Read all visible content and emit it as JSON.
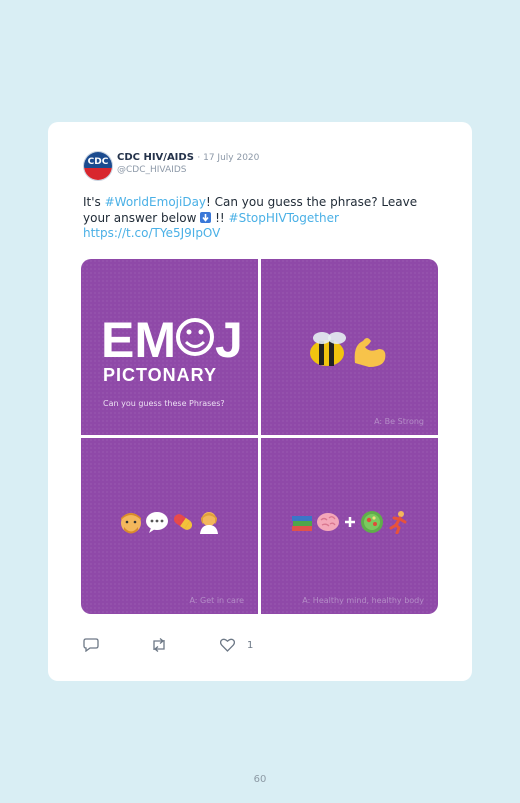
{
  "tweet": {
    "display_name": "CDC HIV/AIDS",
    "date": "· 17 July 2020",
    "handle": "@CDC_HIVAIDS",
    "text_part1": "It's ",
    "hashtag1": "#WorldEmojiDay",
    "text_part2": "! Can you guess the phrase? Leave your answer below ",
    "text_part3": " !! ",
    "hashtag2": "#StopHIVTogether",
    "link": "https://t.co/TYe5J9IpOV"
  },
  "tiles": {
    "title_emoji": "EMOJI",
    "title_pictonary": "PICTONARY",
    "question": "Can you guess these Phrases?",
    "answer2": "A: Be Strong",
    "answer3": "A: Get in care",
    "answer4": "A: Healthy mind, healthy body"
  },
  "actions": {
    "like_count": "1"
  },
  "page_number": "60",
  "colors": {
    "tile_purple": "#8f49a8",
    "link_blue": "#4ab0e6",
    "background": "#d9eef4"
  }
}
